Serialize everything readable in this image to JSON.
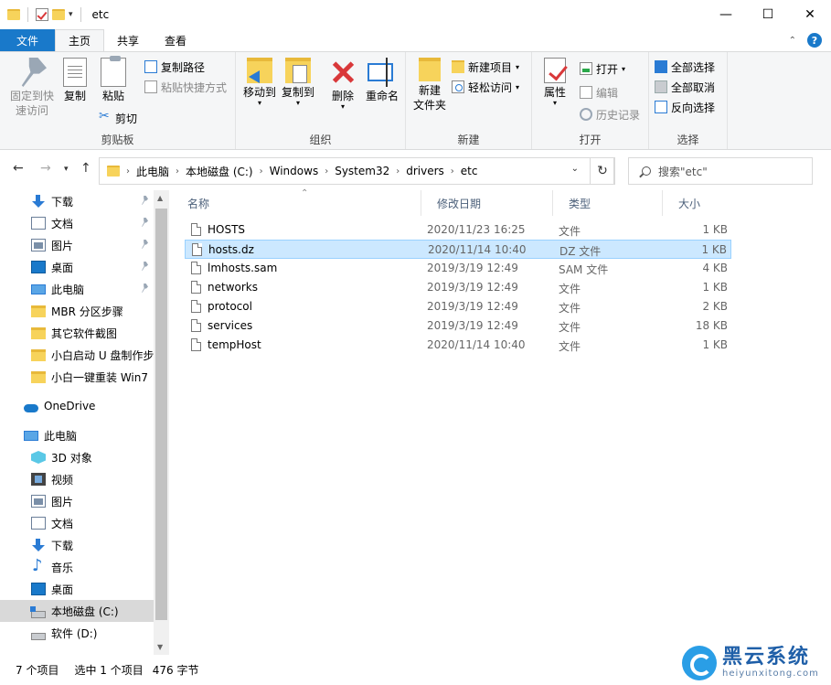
{
  "window": {
    "title": "etc",
    "controls": {
      "minimize": "—",
      "maximize": "☐",
      "close": "✕"
    }
  },
  "tabs": [
    {
      "label": "文件"
    },
    {
      "label": "主页"
    },
    {
      "label": "共享"
    },
    {
      "label": "查看"
    }
  ],
  "ribbon": {
    "clipboard": {
      "label": "剪贴板",
      "pin_quick_line1": "固定到快",
      "pin_quick_line2": "速访问",
      "copy": "复制",
      "paste": "粘贴",
      "copy_path": "复制路径",
      "paste_shortcut": "粘贴快捷方式",
      "cut": "剪切"
    },
    "organize": {
      "label": "组织",
      "move_to": "移动到",
      "copy_to": "复制到",
      "delete": "删除",
      "rename": "重命名"
    },
    "new": {
      "label": "新建",
      "new_folder_line1": "新建",
      "new_folder_line2": "文件夹",
      "new_item": "新建项目",
      "easy_access": "轻松访问"
    },
    "open": {
      "label": "打开",
      "properties": "属性",
      "open": "打开",
      "edit": "编辑",
      "history": "历史记录"
    },
    "select": {
      "label": "选择",
      "select_all": "全部选择",
      "select_none": "全部取消",
      "invert": "反向选择"
    }
  },
  "address": {
    "crumbs": [
      "此电脑",
      "本地磁盘 (C:)",
      "Windows",
      "System32",
      "drivers",
      "etc"
    ],
    "search_placeholder": "搜索\"etc\""
  },
  "nav_pane": {
    "quick_access": [
      {
        "label": "下载",
        "icon": "download-icon",
        "pinned": true
      },
      {
        "label": "文档",
        "icon": "document-icon",
        "pinned": true
      },
      {
        "label": "图片",
        "icon": "picture-icon",
        "pinned": true
      },
      {
        "label": "桌面",
        "icon": "desktop-icon",
        "pinned": true
      },
      {
        "label": "此电脑",
        "icon": "pc-icon",
        "pinned": true
      },
      {
        "label": "MBR 分区步骤",
        "icon": "folder-icon",
        "pinned": false
      },
      {
        "label": "其它软件截图",
        "icon": "folder-icon",
        "pinned": false
      },
      {
        "label": "小白启动 U 盘制作步",
        "icon": "folder-icon",
        "pinned": false
      },
      {
        "label": "小白一键重装 Win7 ",
        "icon": "folder-icon",
        "pinned": false
      }
    ],
    "onedrive": "OneDrive",
    "this_pc": "此电脑",
    "pc_items": [
      {
        "label": "3D 对象",
        "icon": "3d-objects-icon"
      },
      {
        "label": "视频",
        "icon": "video-icon"
      },
      {
        "label": "图片",
        "icon": "picture-icon"
      },
      {
        "label": "文档",
        "icon": "document-icon"
      },
      {
        "label": "下载",
        "icon": "download-icon"
      },
      {
        "label": "音乐",
        "icon": "music-icon"
      },
      {
        "label": "桌面",
        "icon": "desktop-icon"
      },
      {
        "label": "本地磁盘 (C:)",
        "icon": "local-disk-icon"
      },
      {
        "label": "软件 (D:)",
        "icon": "drive-icon"
      }
    ]
  },
  "file_list": {
    "columns": {
      "name": "名称",
      "date": "修改日期",
      "type": "类型",
      "size": "大小"
    },
    "rows": [
      {
        "name": "HOSTS",
        "date": "2020/11/23 16:25",
        "type": "文件",
        "size": "1 KB"
      },
      {
        "name": "hosts.dz",
        "date": "2020/11/14 10:40",
        "type": "DZ 文件",
        "size": "1 KB"
      },
      {
        "name": "lmhosts.sam",
        "date": "2019/3/19 12:49",
        "type": "SAM 文件",
        "size": "4 KB"
      },
      {
        "name": "networks",
        "date": "2019/3/19 12:49",
        "type": "文件",
        "size": "1 KB"
      },
      {
        "name": "protocol",
        "date": "2019/3/19 12:49",
        "type": "文件",
        "size": "2 KB"
      },
      {
        "name": "services",
        "date": "2019/3/19 12:49",
        "type": "文件",
        "size": "18 KB"
      },
      {
        "name": "tempHost",
        "date": "2020/11/14 10:40",
        "type": "文件",
        "size": "1 KB"
      }
    ],
    "selected_index": 1
  },
  "status": {
    "item_count": "7 个项目",
    "selected": "选中 1 个项目",
    "size": "476 字节"
  },
  "watermark": {
    "title": "黑云系统",
    "url": "heiyunxitong.com"
  }
}
